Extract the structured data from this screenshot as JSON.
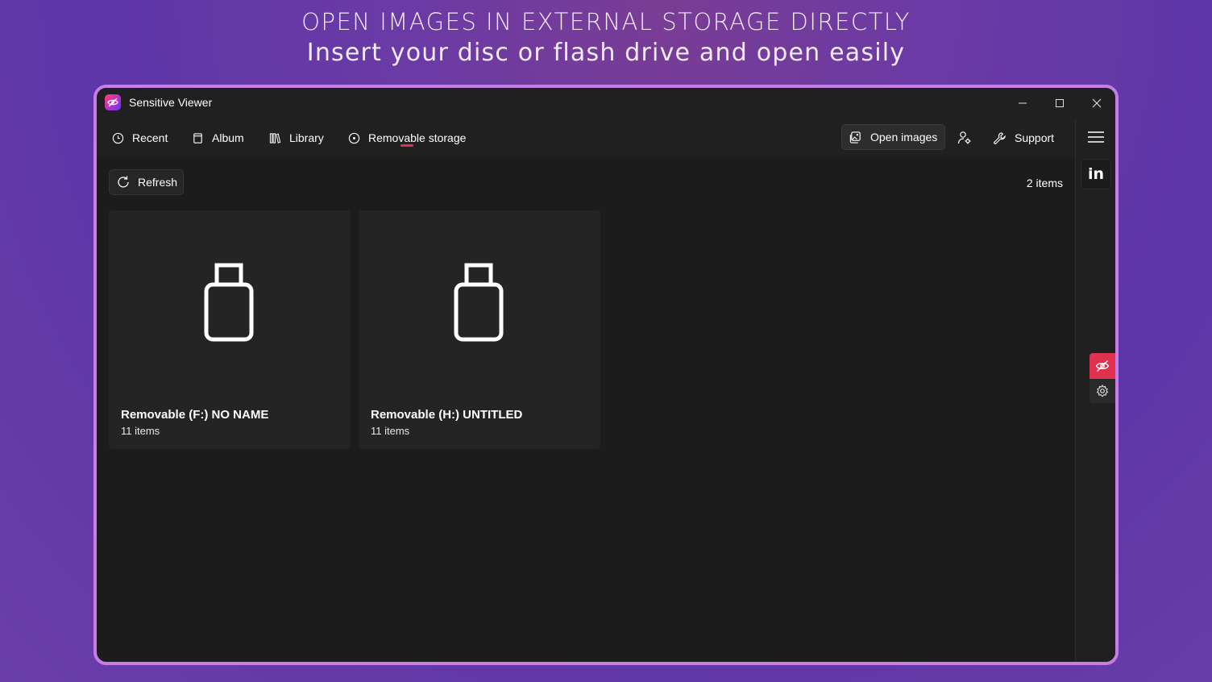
{
  "promo": {
    "headline": "OPEN IMAGES IN EXTERNAL STORAGE DIRECTLY",
    "subheadline": "Insert your disc or flash drive and open easily"
  },
  "window": {
    "title": "Sensitive Viewer",
    "controls": [
      "minimize",
      "maximize",
      "close"
    ]
  },
  "nav": {
    "items": [
      {
        "label": "Recent",
        "icon": "clock-icon"
      },
      {
        "label": "Album",
        "icon": "album-icon"
      },
      {
        "label": "Library",
        "icon": "library-icon"
      },
      {
        "label": "Removable storage",
        "icon": "disc-icon",
        "selected": true
      }
    ],
    "open_images_label": "Open images",
    "support_label": "Support"
  },
  "toolbar": {
    "refresh_label": "Refresh",
    "item_count": "2 items"
  },
  "drives": [
    {
      "name": "Removable (F:) NO NAME",
      "count": "11 items",
      "icon": "usb-drive-icon"
    },
    {
      "name": "Removable (H:) UNTITLED",
      "count": "11 items",
      "icon": "usb-drive-icon"
    }
  ],
  "sidebar": {
    "linkedin_label": "in"
  },
  "colors": {
    "accent": "#e0315a",
    "frame": "#c77de6",
    "window_bg": "#1c1c1c",
    "card_bg": "#242424"
  }
}
